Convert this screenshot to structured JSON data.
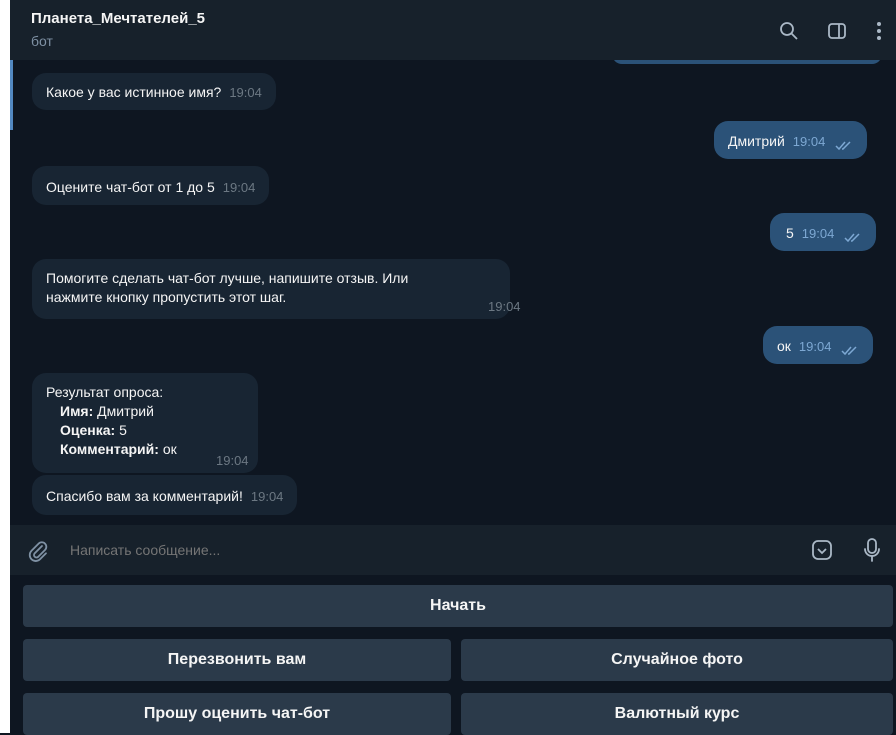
{
  "header": {
    "title": "Планета_Мечтателей_5",
    "subtitle": "бот"
  },
  "messages": [
    {
      "dir": "in",
      "text": "Какое у вас истинное имя?",
      "time": "19:04"
    },
    {
      "dir": "out",
      "text": "Дмитрий",
      "time": "19:04"
    },
    {
      "dir": "in",
      "text": "Оцените чат-бот от 1 до 5",
      "time": "19:04"
    },
    {
      "dir": "out",
      "text": "5",
      "time": "19:04"
    },
    {
      "dir": "in",
      "text_line1": "Помогите сделать чат-бот лучше, напишите отзыв. Или",
      "text_line2": "нажмите кнопку пропустить этот шаг.",
      "time": "19:04"
    },
    {
      "dir": "out",
      "text": "ок",
      "time": "19:04"
    },
    {
      "dir": "in",
      "title": "Результат опроса:",
      "rows": [
        {
          "label": "Имя:",
          "value": " Дмитрий"
        },
        {
          "label": "Оценка:",
          "value": " 5"
        },
        {
          "label": "Комментарий:",
          "value": " ок"
        }
      ],
      "time": "19:04"
    },
    {
      "dir": "in",
      "text": "Спасибо вам за комментарий!",
      "time": "19:04"
    }
  ],
  "composer": {
    "placeholder": "Написать сообщение..."
  },
  "keyboard": {
    "start": "Начать",
    "call_back": "Перезвонить вам",
    "random_photo": "Случайное фото",
    "rate_bot": "Прошу оценить чат-бот",
    "currency": "Валютный курс"
  },
  "colors": {
    "background": "#0e1621",
    "header": "#17212b",
    "incoming_bubble": "#182533",
    "outgoing_bubble": "#2b5278",
    "keyboard_button": "#2b3a4a"
  },
  "icons": {
    "search": "search-icon",
    "side_panel": "sidebar-toggle-icon",
    "menu": "more-vertical-icon",
    "attach": "paperclip-icon",
    "emoji": "bot-commands-icon",
    "mic": "microphone-icon",
    "read": "double-check-icon"
  }
}
